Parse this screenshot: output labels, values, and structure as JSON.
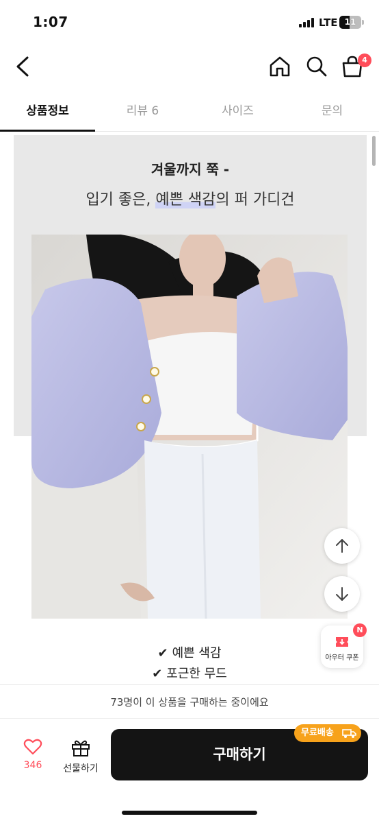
{
  "status_bar": {
    "time": "1:07",
    "network": "LTE",
    "battery": "11"
  },
  "header": {
    "cart_count": "4"
  },
  "tabs": [
    {
      "label": "상품정보",
      "active": true
    },
    {
      "label": "리뷰 6",
      "active": false
    },
    {
      "label": "사이즈",
      "active": false
    },
    {
      "label": "문의",
      "active": false
    }
  ],
  "product_detail": {
    "headline_line1": "겨울까지 쭉 -",
    "headline_line2_pre": "입기 좋은, ",
    "headline_line2_highlight": "예쁜 색감",
    "headline_line2_post": "의 퍼 가디건",
    "checks": [
      "예쁜 색감",
      "포근한 무드"
    ],
    "check_symbol": "✔"
  },
  "floating": {
    "coupon_label": "아우터 쿠폰",
    "coupon_badge": "N"
  },
  "purchase_info": {
    "text": "73명이 이 상품을 구매하는 중이에요"
  },
  "bottom_bar": {
    "like_count": "346",
    "gift_label": "선물하기",
    "buy_label": "구매하기",
    "shipping_badge": "무료배송"
  },
  "colors": {
    "accent_red": "#ff4d5a",
    "shipping_orange": "#f7a21b",
    "buy_button": "#141414"
  }
}
